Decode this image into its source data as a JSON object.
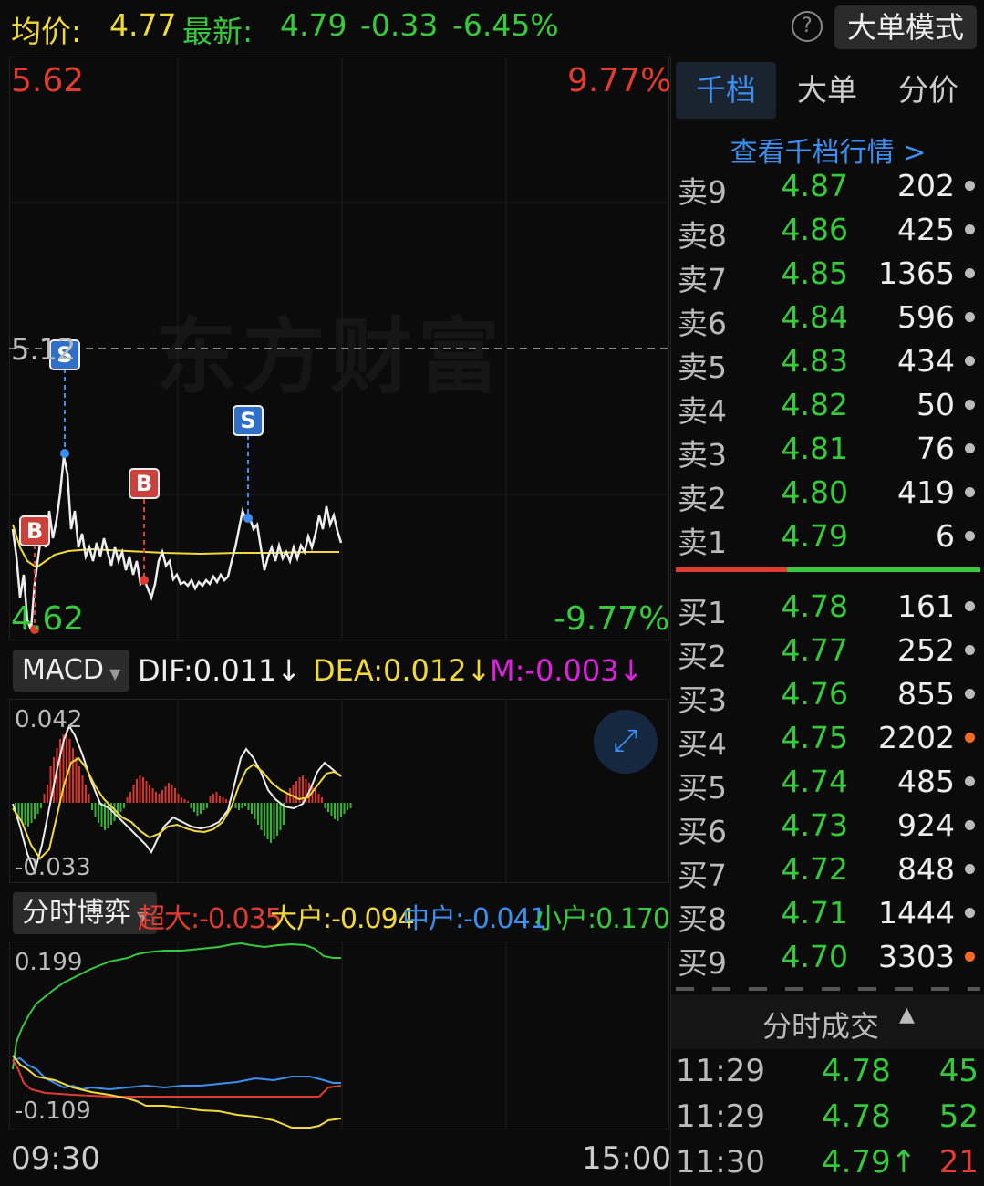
{
  "header": {
    "avg_label": "均价:",
    "avg_value": "4.77",
    "latest_label": "最新:",
    "latest_value": "4.79",
    "change": "-0.33",
    "change_pct": "-6.45%",
    "help_icon": "?",
    "mode_button": "大单模式"
  },
  "main_chart": {
    "high_price": "5.62",
    "high_pct": "9.77%",
    "low_price": "4.62",
    "low_pct": "-9.77%",
    "ref_price": "5.12",
    "watermark": "东方财富",
    "markers": [
      "B",
      "S",
      "B",
      "S"
    ]
  },
  "macd": {
    "selector": "MACD",
    "dif": "DIF:0.011↓",
    "dea": "DEA:0.012↓",
    "m": "M:-0.003↓",
    "top": "0.042",
    "bottom": "-0.033"
  },
  "fund_flow": {
    "selector": "分时博弈",
    "super": "超大:-0.035",
    "large": "大户:-0.094",
    "medium": "中户:-0.041",
    "small": "小户:0.170",
    "top": "0.199",
    "bottom": "-0.109"
  },
  "time_axis": {
    "start": "09:30",
    "end": "15:00"
  },
  "right_panel": {
    "tabs": [
      "千档",
      "大单",
      "分价"
    ],
    "view_link": "查看千档行情 >",
    "asks": [
      {
        "label": "卖9",
        "price": "4.87",
        "vol": "202",
        "dot": "grey"
      },
      {
        "label": "卖8",
        "price": "4.86",
        "vol": "425",
        "dot": "grey"
      },
      {
        "label": "卖7",
        "price": "4.85",
        "vol": "1365",
        "dot": "grey"
      },
      {
        "label": "卖6",
        "price": "4.84",
        "vol": "596",
        "dot": "grey"
      },
      {
        "label": "卖5",
        "price": "4.83",
        "vol": "434",
        "dot": "grey"
      },
      {
        "label": "卖4",
        "price": "4.82",
        "vol": "50",
        "dot": "grey"
      },
      {
        "label": "卖3",
        "price": "4.81",
        "vol": "76",
        "dot": "grey"
      },
      {
        "label": "卖2",
        "price": "4.80",
        "vol": "419",
        "dot": "grey"
      },
      {
        "label": "卖1",
        "price": "4.79",
        "vol": "6",
        "dot": "grey"
      }
    ],
    "bids": [
      {
        "label": "买1",
        "price": "4.78",
        "vol": "161",
        "dot": "grey"
      },
      {
        "label": "买2",
        "price": "4.77",
        "vol": "252",
        "dot": "grey"
      },
      {
        "label": "买3",
        "price": "4.76",
        "vol": "855",
        "dot": "grey"
      },
      {
        "label": "买4",
        "price": "4.75",
        "vol": "2202",
        "dot": "orange"
      },
      {
        "label": "买5",
        "price": "4.74",
        "vol": "485",
        "dot": "grey"
      },
      {
        "label": "买6",
        "price": "4.73",
        "vol": "924",
        "dot": "grey"
      },
      {
        "label": "买7",
        "price": "4.72",
        "vol": "848",
        "dot": "grey"
      },
      {
        "label": "买8",
        "price": "4.71",
        "vol": "1444",
        "dot": "grey"
      },
      {
        "label": "买9",
        "price": "4.70",
        "vol": "3303",
        "dot": "orange"
      }
    ],
    "trades_title": "分时成交",
    "trades": [
      {
        "time": "11:29",
        "price": "4.78",
        "vol": "45",
        "up": false
      },
      {
        "time": "11:29",
        "price": "4.78",
        "vol": "52",
        "up": false
      },
      {
        "time": "11:30",
        "price": "4.79↑",
        "vol": "21",
        "up": true
      }
    ]
  },
  "colors": {
    "up": "#e23b2f",
    "down": "#37c93c",
    "avg": "#f2d93a",
    "accent": "#3a8ff0"
  }
}
